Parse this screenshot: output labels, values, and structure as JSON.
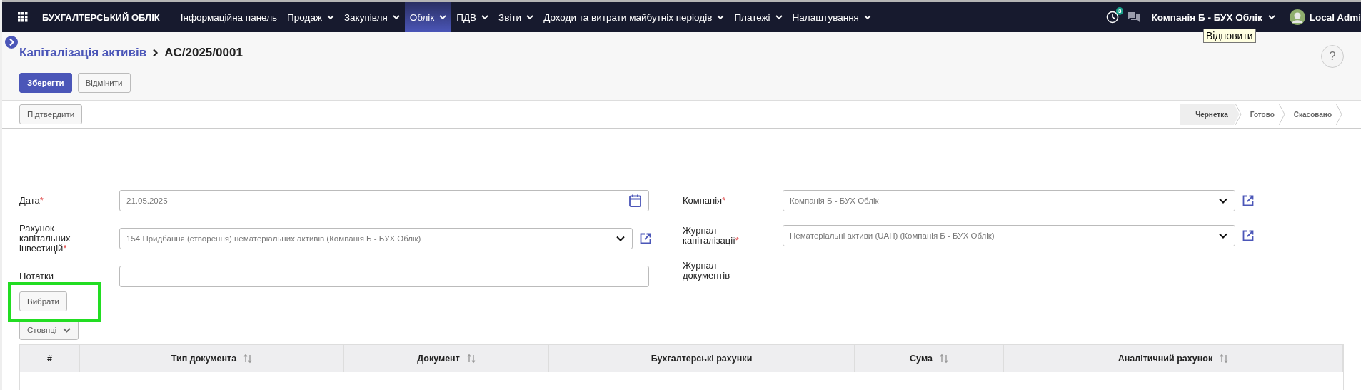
{
  "navbar": {
    "app_title": "БУХГАЛТЕРСЬКИЙ ОБЛІК",
    "menus": [
      {
        "label": "Інформаційна панель",
        "dropdown": false,
        "selected": false
      },
      {
        "label": "Продаж",
        "dropdown": true,
        "selected": false
      },
      {
        "label": "Закупівля",
        "dropdown": true,
        "selected": false
      },
      {
        "label": "Облік",
        "dropdown": true,
        "selected": true
      },
      {
        "label": "ПДВ",
        "dropdown": true,
        "selected": false
      },
      {
        "label": "Звіти",
        "dropdown": true,
        "selected": false
      },
      {
        "label": "Доходи та витрати майбутніх періодів",
        "dropdown": true,
        "selected": false
      },
      {
        "label": "Платежі",
        "dropdown": true,
        "selected": false
      },
      {
        "label": "Налаштування",
        "dropdown": true,
        "selected": false
      }
    ],
    "activity_count": "3",
    "company": "Компанія Б - БУХ Облік",
    "user": "Local Admi"
  },
  "tooltip": "Відновити",
  "breadcrumb": {
    "parent": "Капіталізація активів",
    "current": "AC/2025/0001"
  },
  "help": "?",
  "buttons": [
    {
      "label": "Зберегти",
      "kind": "primary"
    },
    {
      "label": "Відмінити",
      "kind": "secondary"
    }
  ],
  "status_bar": {
    "actions": [
      "Підтвердити"
    ],
    "steps": [
      {
        "label": "Чернетка",
        "selected": true
      },
      {
        "label": "Готово",
        "selected": false
      },
      {
        "label": "Скасовано",
        "selected": false
      }
    ]
  },
  "form": {
    "left": [
      {
        "label": "Дата",
        "required_mark": "*",
        "kind": "date",
        "value": "21.05.2025"
      },
      {
        "label": "Рахунок капітальних інвестицій",
        "required_mark": "*",
        "kind": "select",
        "value": "154 Придбання (створення) нематеріальних активів (Компанія Б - БУХ Облік)",
        "external_link": true
      },
      {
        "label": "Нотатки",
        "kind": "text"
      }
    ],
    "right": [
      {
        "label": "Компанія",
        "required_mark": "*",
        "kind": "select",
        "value": "Компанія Б - БУХ Облік",
        "external_link": true
      },
      {
        "label": "Журнал капіталізації",
        "required_mark": "*",
        "kind": "select",
        "value": "Нематеріальні активи (UAH) (Компанія Б - БУХ Облік)",
        "external_link": true
      },
      {
        "label": "Журнал документів",
        "kind": "none"
      }
    ]
  },
  "select_button": {
    "label": "Вибрати",
    "highlighted": true
  },
  "columns_button": "Стовпці",
  "table": {
    "columns": [
      {
        "label": "#",
        "sortable": false
      },
      {
        "label": "Тип документа",
        "sortable": true
      },
      {
        "label": "Документ",
        "sortable": true
      },
      {
        "label": "Бухгалтерські рахунки",
        "sortable": false
      },
      {
        "label": "Сума",
        "sortable": true
      },
      {
        "label": "Аналітичний рахунок",
        "sortable": true
      }
    ]
  }
}
